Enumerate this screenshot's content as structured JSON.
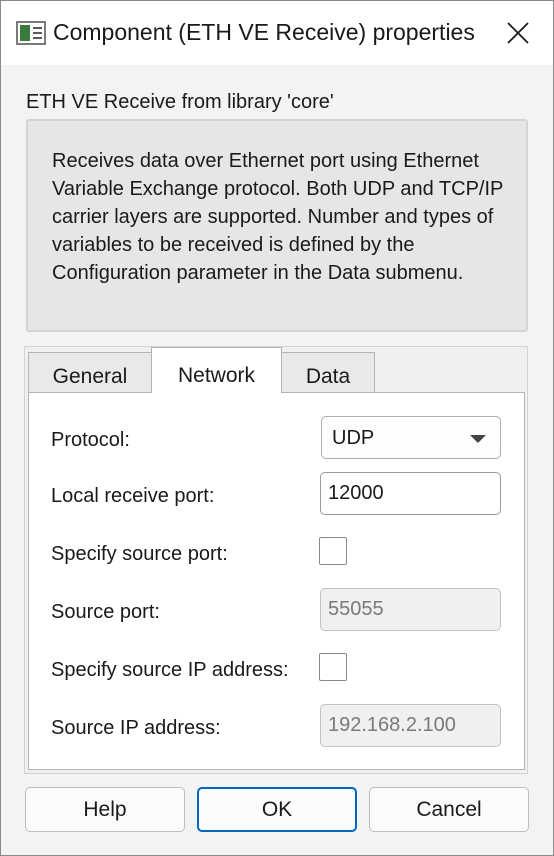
{
  "window": {
    "title": "Component (ETH VE Receive) properties",
    "accent_color": "#0067c0"
  },
  "library_label": "ETH VE Receive from library 'core'",
  "description": "Receives data over Ethernet port using Ethernet Variable Exchange protocol. Both UDP and TCP/IP carrier layers are supported. Number and types of variables to be received is defined by the Configuration parameter in the Data submenu.",
  "tabs": [
    {
      "label": "General",
      "selected": false
    },
    {
      "label": "Network",
      "selected": true
    },
    {
      "label": "Data",
      "selected": false
    }
  ],
  "network": {
    "protocol_label": "Protocol:",
    "protocol_value": "UDP",
    "local_port_label": "Local receive port:",
    "local_port_value": "12000",
    "specify_source_port_label": "Specify source port:",
    "specify_source_port_checked": false,
    "source_port_label": "Source port:",
    "source_port_value": "55055",
    "specify_source_ip_label": "Specify source IP address:",
    "specify_source_ip_checked": false,
    "source_ip_label": "Source IP address:",
    "source_ip_value": "192.168.2.100"
  },
  "buttons": {
    "help": "Help",
    "ok": "OK",
    "cancel": "Cancel"
  }
}
